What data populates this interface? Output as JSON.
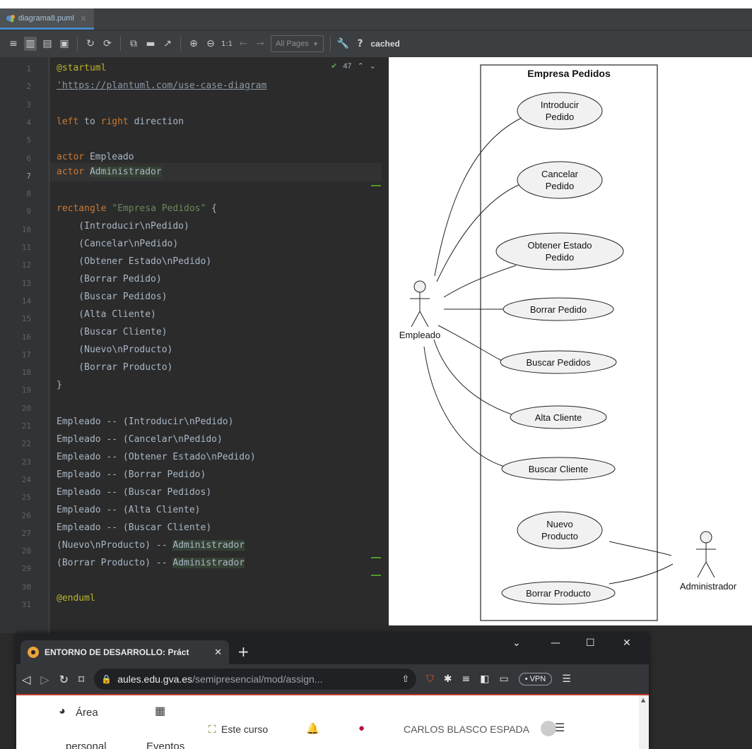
{
  "ide": {
    "tab_filename": "diagrama8.puml",
    "toolbar": {
      "pages_select": "All Pages",
      "help": "?",
      "status": "cached",
      "zoom_reset": "1:1"
    },
    "inspection_count": "47",
    "line_numbers": [
      "1",
      "2",
      "3",
      "4",
      "5",
      "6",
      "7",
      "8",
      "9",
      "10",
      "11",
      "12",
      "13",
      "14",
      "15",
      "16",
      "17",
      "18",
      "19",
      "20",
      "21",
      "22",
      "23",
      "24",
      "25",
      "26",
      "27",
      "28",
      "29",
      "30",
      "31"
    ],
    "code": {
      "l1": "@startuml",
      "l2": "'https://plantuml.com/use-case-diagram",
      "l4a": "left",
      "l4b": " to ",
      "l4c": "right",
      "l4d": " direction",
      "l6a": "actor",
      "l6b": " Empleado",
      "l7a": "actor",
      "l7b": " ",
      "l7c": "Administrador",
      "l9a": "rectangle",
      "l9b": " ",
      "l9c": "\"Empresa Pedidos\"",
      "l9d": " {",
      "l10": "    (Introducir\\nPedido)",
      "l11": "    (Cancelar\\nPedido)",
      "l12": "    (Obtener Estado\\nPedido)",
      "l13": "    (Borrar Pedido)",
      "l14": "    (Buscar Pedidos)",
      "l15": "    (Alta Cliente)",
      "l16": "    (Buscar Cliente)",
      "l17": "    (Nuevo\\nProducto)",
      "l18": "    (Borrar Producto)",
      "l19": "}",
      "l21": "Empleado -- (Introducir\\nPedido)",
      "l22": "Empleado -- (Cancelar\\nPedido)",
      "l23": "Empleado -- (Obtener Estado\\nPedido)",
      "l24": "Empleado -- (Borrar Pedido)",
      "l25": "Empleado -- (Buscar Pedidos)",
      "l26": "Empleado -- (Alta Cliente)",
      "l27": "Empleado -- (Buscar Cliente)",
      "l28a": "(Nuevo\\nProducto) -- ",
      "l28b": "Administrador",
      "l29a": "(Borrar Producto) -- ",
      "l29b": "Administrador",
      "l31": "@enduml"
    }
  },
  "diagram": {
    "system_title": "Empresa Pedidos",
    "actor_empleado": "Empleado",
    "actor_admin": "Administrador",
    "uc_introducir": [
      "Introducir",
      "Pedido"
    ],
    "uc_cancelar": [
      "Cancelar",
      "Pedido"
    ],
    "uc_obtener": [
      "Obtener Estado",
      "Pedido"
    ],
    "uc_borrar_pedido": "Borrar Pedido",
    "uc_buscar_pedidos": "Buscar Pedidos",
    "uc_alta_cliente": "Alta Cliente",
    "uc_buscar_cliente": "Buscar Cliente",
    "uc_nuevo_producto": [
      "Nuevo",
      "Producto"
    ],
    "uc_borrar_producto": "Borrar Producto"
  },
  "browser": {
    "tab_title": "ENTORNO DE DESARROLLO: Práct",
    "url_host": "aules.edu.gva.es",
    "url_path": "/semipresencial/mod/assign...",
    "vpn": "• VPN",
    "nav_area": "Área",
    "nav_area2": "personal",
    "nav_eventos2": "Eventos",
    "nav_course": "Este curso",
    "user_name": "CARLOS BLASCO ESPADA"
  }
}
